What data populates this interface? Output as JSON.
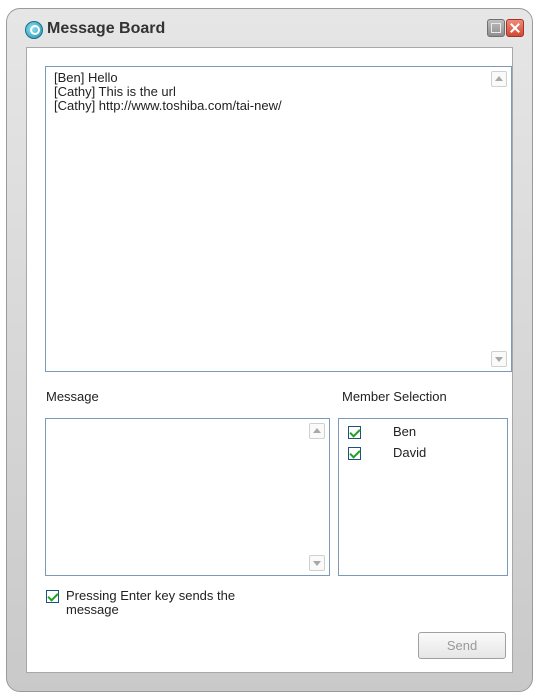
{
  "window": {
    "title": "Message Board"
  },
  "history": {
    "lines": [
      "[Ben] Hello",
      "[Cathy] This is the url",
      "[Cathy] http://www.toshiba.com/tai-new/"
    ]
  },
  "message": {
    "label": "Message",
    "value": ""
  },
  "members": {
    "label": "Member Selection",
    "items": [
      {
        "name": "Ben",
        "checked": true
      },
      {
        "name": "David",
        "checked": true
      }
    ]
  },
  "options": {
    "enter_sends_label": "Pressing Enter key sends the message",
    "enter_sends_checked": true
  },
  "actions": {
    "send_label": "Send"
  },
  "colors": {
    "panel_border": "#7a99bb",
    "check_green": "#21a121",
    "close_red": "#d04a34"
  }
}
